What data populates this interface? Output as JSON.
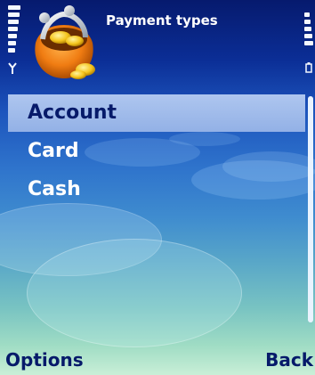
{
  "header": {
    "title": "Payment types",
    "app_icon": "coin-purse-icon",
    "signal_icon": "signal-strength-icon",
    "battery_icon": "battery-level-icon"
  },
  "list": {
    "items": [
      {
        "label": "Account",
        "selected": true
      },
      {
        "label": "Card",
        "selected": false
      },
      {
        "label": "Cash",
        "selected": false
      }
    ]
  },
  "softkeys": {
    "left_label": "Options",
    "right_label": "Back"
  },
  "colors": {
    "selection": "#9db8ea",
    "background_top": "#061a6e",
    "background_bottom": "#c9efd7",
    "softkey_text": "#061a6a"
  }
}
